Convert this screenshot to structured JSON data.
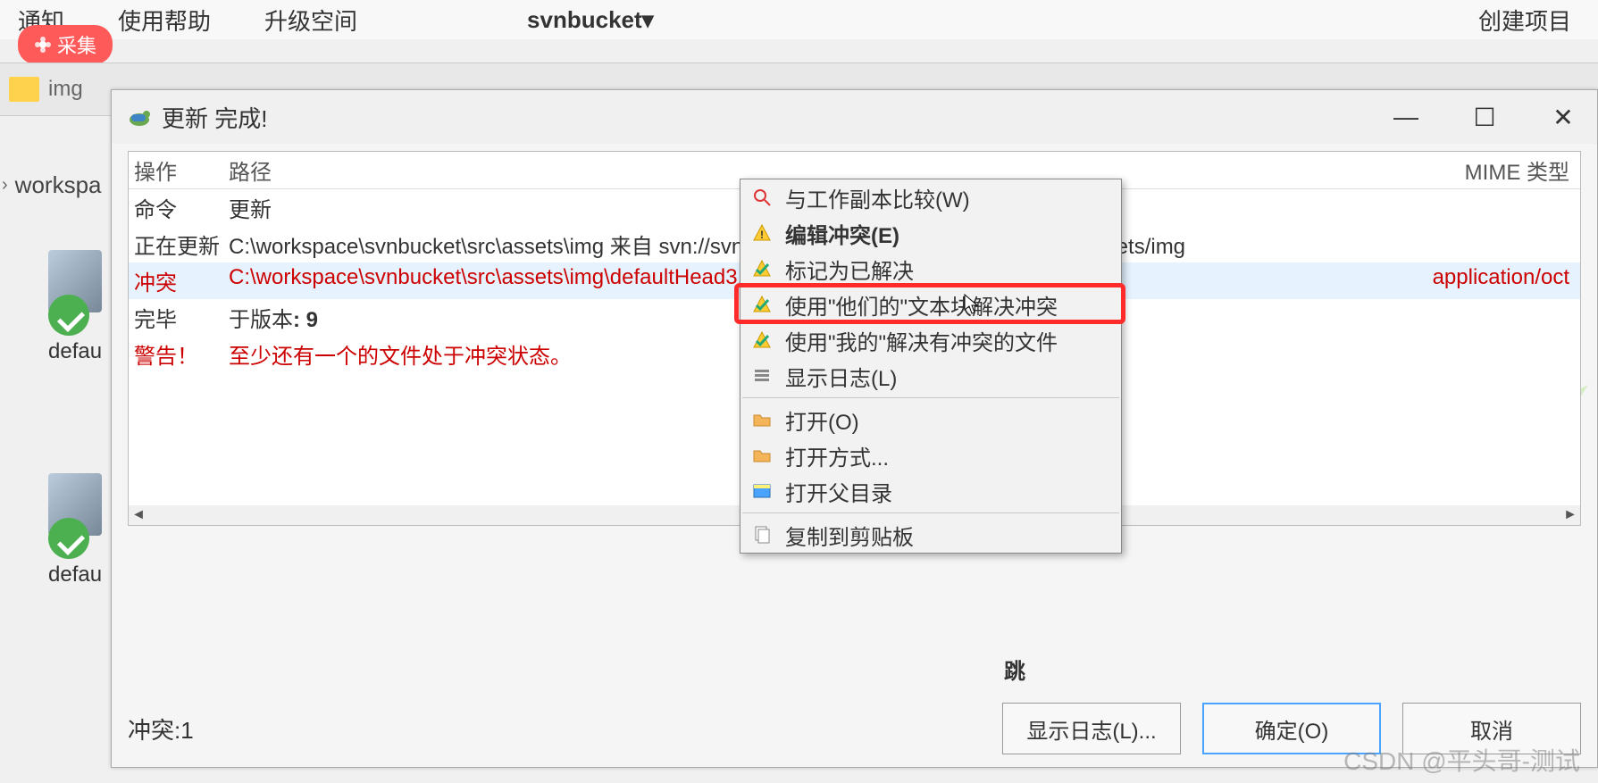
{
  "top_nav": {
    "items": [
      "通知",
      "使用帮助",
      "升级空间"
    ],
    "brand": "svnbucket▾",
    "right": "创建项目"
  },
  "collect": "采集",
  "explorer": {
    "folder": "img"
  },
  "breadcrumb": {
    "item": "workspa"
  },
  "thumbs": {
    "label1": "defau",
    "label2": "defau"
  },
  "dialog": {
    "title": "更新 完成!",
    "headers": {
      "op": "操作",
      "path": "路径",
      "mime": "MIME 类型"
    },
    "rows": [
      {
        "op": "命令",
        "path": "更新"
      },
      {
        "op": "正在更新",
        "path": "C:\\workspace\\svnbucket\\src\\assets\\img 来自 svn://svnbucket.com/learnsvn/svnbucket/src/assets/img"
      },
      {
        "op": "冲突",
        "path": "C:\\workspace\\svnbucket\\src\\assets\\img\\defaultHead3.png",
        "mime": "application/oct",
        "cls": "conflict-row"
      },
      {
        "op": "完毕",
        "path_prefix": "于版本",
        "path_bold": ": 9"
      },
      {
        "op": "警告！",
        "path": "至少还有一个的文件处于冲突状态。",
        "cls": "warn-row"
      }
    ],
    "skip_label": "跳",
    "conflict_count": "冲突:1",
    "buttons": {
      "showlog": "显示日志(L)...",
      "ok": "确定(O)",
      "cancel": "取消"
    }
  },
  "menu": {
    "items": [
      {
        "label": "与工作副本比较(W)",
        "icon": "magnifier-icon"
      },
      {
        "label": "编辑冲突(E)",
        "icon": "warning-icon",
        "bold": true
      },
      {
        "label": "标记为已解决",
        "icon": "resolve-icon"
      },
      {
        "label": "使用\"他们的\"文本块解决冲突",
        "icon": "resolve-icon",
        "highlight": true
      },
      {
        "label": "使用\"我的\"解决有冲突的文件",
        "icon": "resolve-icon"
      },
      {
        "label": "显示日志(L)",
        "icon": "log-icon"
      },
      {
        "sep": true
      },
      {
        "label": "打开(O)",
        "icon": "folder-icon"
      },
      {
        "label": "打开方式...",
        "icon": "folder-icon"
      },
      {
        "label": "打开父目录",
        "icon": "folder-app-icon"
      },
      {
        "sep": true
      },
      {
        "label": "复制到剪贴板",
        "icon": "copy-icon"
      }
    ]
  },
  "watermark": "CSDN @平头哥-测试"
}
